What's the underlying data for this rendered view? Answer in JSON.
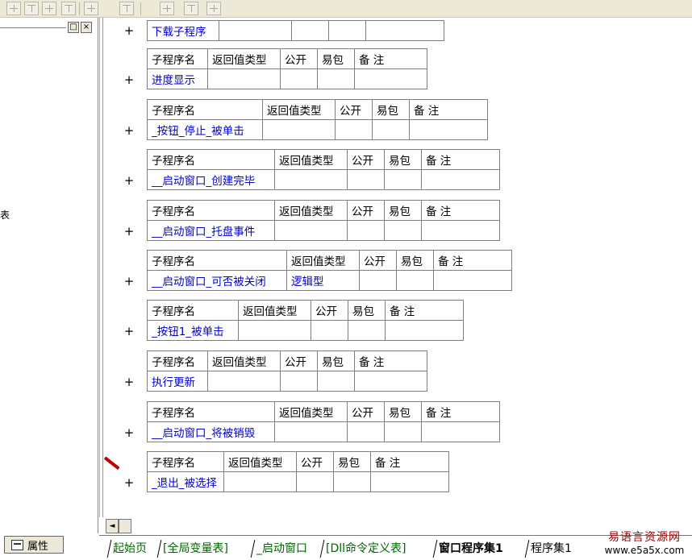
{
  "toolbar": {
    "icons": [
      "align-left-icon",
      "align-center-icon",
      "align-top-icon",
      "align-middle-icon",
      "equal-width-icon",
      "equal-height-icon",
      "same-width-icon",
      "same-height-icon",
      "same-size-icon"
    ]
  },
  "left_panel": {
    "cut_text": "表",
    "restore_btn": "□",
    "close_btn": "×"
  },
  "properties_tab": {
    "label": "属性"
  },
  "editor": {
    "download_proc": {
      "name": "下载子程序"
    },
    "procedures": [
      {
        "headers": [
          "子程序名",
          "返回值类型",
          "公开",
          "易包",
          "备 注"
        ],
        "name": "进度显示",
        "return_type": ""
      },
      {
        "headers": [
          "子程序名",
          "返回值类型",
          "公开",
          "易包",
          "备 注"
        ],
        "name": "_按钮_停止_被单击",
        "return_type": ""
      },
      {
        "headers": [
          "子程序名",
          "返回值类型",
          "公开",
          "易包",
          "备 注"
        ],
        "name": "__启动窗口_创建完毕",
        "return_type": ""
      },
      {
        "headers": [
          "子程序名",
          "返回值类型",
          "公开",
          "易包",
          "备 注"
        ],
        "name": "__启动窗口_托盘事件",
        "return_type": ""
      },
      {
        "headers": [
          "子程序名",
          "返回值类型",
          "公开",
          "易包",
          "备 注"
        ],
        "name": "__启动窗口_可否被关闭",
        "return_type": "逻辑型"
      },
      {
        "headers": [
          "子程序名",
          "返回值类型",
          "公开",
          "易包",
          "备 注"
        ],
        "name": "_按钮1_被单击",
        "return_type": ""
      },
      {
        "headers": [
          "子程序名",
          "返回值类型",
          "公开",
          "易包",
          "备 注"
        ],
        "name": "执行更新",
        "return_type": ""
      },
      {
        "headers": [
          "子程序名",
          "返回值类型",
          "公开",
          "易包",
          "备 注"
        ],
        "name": "__启动窗口_将被销毁",
        "return_type": ""
      },
      {
        "headers": [
          "子程序名",
          "返回值类型",
          "公开",
          "易包",
          "备 注"
        ],
        "name": "_退出_被选择",
        "return_type": ""
      }
    ],
    "expand_symbol": "+"
  },
  "scrollbar": {
    "left_arrow": "◄"
  },
  "tabs": [
    {
      "label": "起始页",
      "active": false
    },
    {
      "label": "[全局变量表]",
      "active": false
    },
    {
      "label": "_启动窗口",
      "active": false
    },
    {
      "label": "[Dll命令定义表]",
      "active": false
    },
    {
      "label": "窗口程序集1",
      "active": true
    },
    {
      "label": "程序集1",
      "active": false
    }
  ],
  "brand": {
    "name": "易语言资源网",
    "url": "www.e5a5x.com"
  },
  "colors": {
    "link_text": "#0000cc",
    "tab_link": "#006600",
    "pencil": "#c00000",
    "brand": "#a00000"
  }
}
